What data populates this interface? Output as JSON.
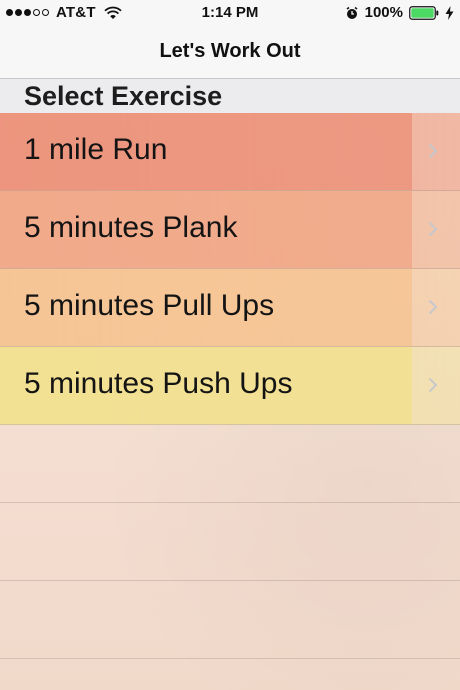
{
  "status_bar": {
    "carrier": "AT&T",
    "signal_bars_filled": 3,
    "signal_bars_total": 5,
    "time": "1:14 PM",
    "battery_percent": "100%",
    "icons": [
      "wifi-icon",
      "alarm-icon",
      "battery-icon",
      "charging-bolt-icon"
    ]
  },
  "nav": {
    "title": "Let's Work Out"
  },
  "section": {
    "title": "Select Exercise"
  },
  "exercises": [
    {
      "label": "1 mile Run",
      "color": "#ee9a80",
      "band_color": "#ec8e76"
    },
    {
      "label": "5 minutes Plank",
      "color": "#f2b08e",
      "band_color": "#f0a483"
    },
    {
      "label": "5 minutes Pull Ups",
      "color": "#f6c99c",
      "band_color": "#f5c18f"
    },
    {
      "label": "5 minutes Push Ups",
      "color": "#f4e3a2",
      "band_color": "#f2e08a"
    }
  ],
  "colors": {
    "status_bar_bg": "#f7f7f7",
    "section_header_bg": "#ececef",
    "chevron": "#c7c7cc",
    "battery_green": "#4cd964"
  }
}
